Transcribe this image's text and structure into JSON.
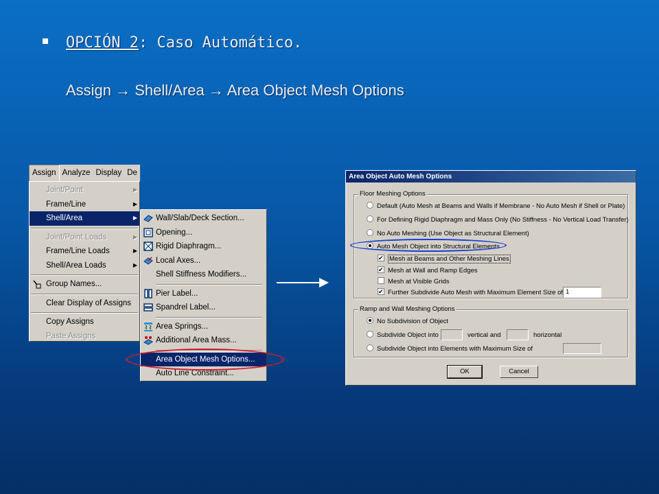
{
  "slide": {
    "heading_underlined": "OPCIÓN 2",
    "heading_rest": ": Caso Automático.",
    "path": "Assign → Shell/Area → Area Object Mesh Options"
  },
  "menubar": [
    "Assign",
    "Analyze",
    "Display",
    "De"
  ],
  "assign_menu": {
    "items": [
      {
        "label": "Joint/Point",
        "disabled": true,
        "submenu": true
      },
      {
        "label": "Frame/Line",
        "disabled": false,
        "submenu": true
      },
      {
        "label": "Shell/Area",
        "disabled": false,
        "submenu": true,
        "selected": true
      },
      {
        "label": "Joint/Point Loads",
        "disabled": true,
        "submenu": true
      },
      {
        "label": "Frame/Line Loads",
        "disabled": false,
        "submenu": true
      },
      {
        "label": "Shell/Area Loads",
        "disabled": false,
        "submenu": true
      },
      {
        "label": "Group Names...",
        "disabled": false
      },
      {
        "label": "Clear Display of Assigns",
        "disabled": false
      },
      {
        "label": "Copy Assigns",
        "disabled": false
      },
      {
        "label": "Paste Assigns",
        "disabled": true
      }
    ]
  },
  "shell_menu": {
    "items": [
      {
        "label": "Wall/Slab/Deck Section...",
        "icon": "section-icon"
      },
      {
        "label": "Opening...",
        "icon": "opening-icon"
      },
      {
        "label": "Rigid Diaphragm...",
        "icon": "diaphragm-icon"
      },
      {
        "label": "Local Axes...",
        "icon": "axes-icon"
      },
      {
        "label": "Shell Stiffness Modifiers...",
        "icon": ""
      },
      {
        "label": "Pier Label...",
        "icon": "pier-icon"
      },
      {
        "label": "Spandrel Label...",
        "icon": "spandrel-icon"
      },
      {
        "label": "Area Springs...",
        "icon": "springs-icon"
      },
      {
        "label": "Additional Area Mass...",
        "icon": "mass-icon"
      },
      {
        "label": "Area Object Mesh Options...",
        "icon": "",
        "selected": true
      },
      {
        "label": "Auto Line Constraint...",
        "icon": ""
      }
    ]
  },
  "dialog": {
    "title": "Area Object Auto Mesh Options",
    "floor_group": "Floor Meshing Options",
    "floor_options": [
      "Default  (Auto Mesh at Beams and Walls if Membrane - No Auto Mesh if Shell or Plate)",
      "For Defining Rigid Diaphragm and Mass Only  (No Stiffness - No Vertical Load Transfer)",
      "No Auto Meshing  (Use Object as Structural Element)",
      "Auto Mesh Object into Structural Elements"
    ],
    "floor_selected": 3,
    "checks": [
      {
        "label": "Mesh at Beams and Other Meshing Lines",
        "checked": true
      },
      {
        "label": "Mesh at Wall and Ramp Edges",
        "checked": true
      },
      {
        "label": "Mesh at Visible Grids",
        "checked": false
      },
      {
        "label": "Further Subdivide Auto Mesh with Maximum Element Size of",
        "checked": true
      }
    ],
    "max_size_value": "1",
    "ramp_group": "Ramp and Wall Meshing Options",
    "ramp_options": [
      "No Subdivision of Object",
      "Subdivide Object into",
      "Subdivide Object into Elements with Maximum Size of"
    ],
    "ramp_selected": 0,
    "vertical_label": "vertical  and",
    "horizontal_label": "horizontal",
    "ok": "OK",
    "cancel": "Cancel"
  }
}
